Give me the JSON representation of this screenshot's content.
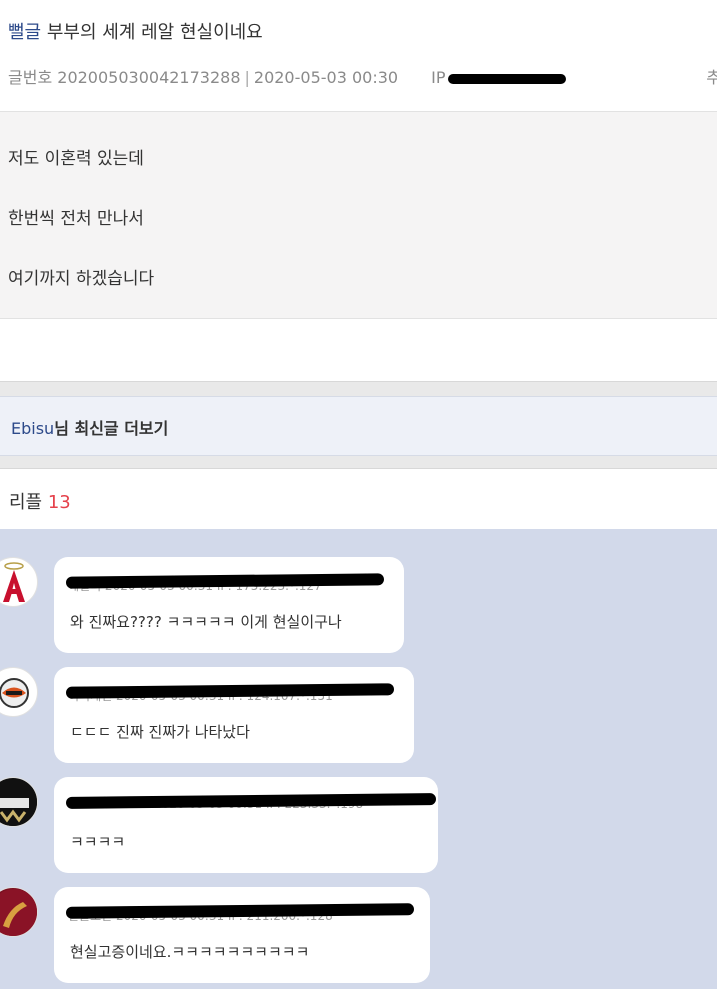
{
  "post": {
    "category": "뻘글",
    "title": "부부의 세계 레알 현실이네요",
    "meta_label": "글번호",
    "post_number": "202005030042173288",
    "date": "2020-05-03 00:30",
    "ip_label": "IP",
    "meta_right": "추",
    "body_lines": [
      "저도 이혼력 있는데",
      "한번씩 전처 만나서",
      "여기까지 하겠습니다"
    ]
  },
  "more": {
    "author": "Ebisu",
    "suffix": "님 최신글 더보기"
  },
  "replies": {
    "label": "리플",
    "count": "13",
    "items": [
      {
        "meta": "에일리 2020-05-03 00:31 IP: 175.223.*.127",
        "text": "와 진짜요???? ㅋㅋㅋㅋㅋ 이게 현실이구나",
        "avatar_icon": "angels-logo-icon"
      },
      {
        "meta": "허리케인 2020-05-03 00:31 IP: 124.107.*.151",
        "text": "ㄷㄷㄷ 진짜 진짜가 나타났다",
        "avatar_icon": "team-logo-icon"
      },
      {
        "meta": "BUCKETHEAD 2020-05-03 00:31 IP: 223.33.*.198",
        "text": "ㅋㅋㅋㅋ",
        "avatar_icon": "spurs-logo-icon"
      },
      {
        "meta": "한글로만 2020-05-03 00:31 IP: 211.200.*.128",
        "text": "현실고증이네요.ㅋㅋㅋㅋㅋㅋㅋㅋㅋㅋ",
        "avatar_icon": "saxophone-icon"
      }
    ]
  },
  "colors": {
    "accent_blue": "#2d4a8a",
    "reply_count_red": "#e5414b",
    "comment_bg": "#d2d9ea",
    "redaction": "#000000"
  }
}
